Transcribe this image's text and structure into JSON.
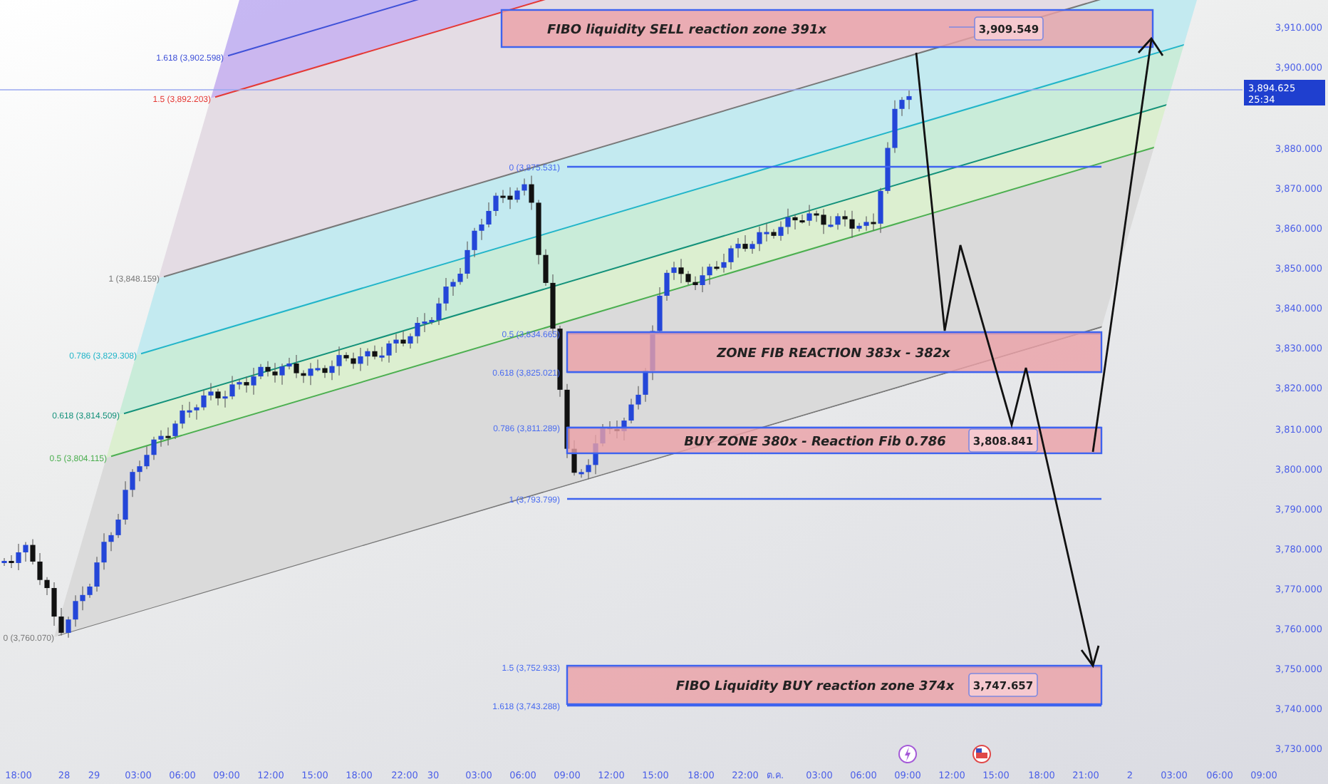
{
  "fib_extension": {
    "levels": [
      {
        "label": "1.618 (3,902.598)",
        "color": "#3f51d8"
      },
      {
        "label": "1.5 (3,892.203)",
        "color": "#e53935"
      },
      {
        "label": "1 (3,848.159)",
        "color": "#787878"
      },
      {
        "label": "0.786 (3,829.308)",
        "color": "#22b5c9"
      },
      {
        "label": "0.618 (3,814.509)",
        "color": "#13917a"
      },
      {
        "label": "0.5 (3,804.115)",
        "color": "#4caf50"
      },
      {
        "label": "0 (3,760.070)",
        "color": "#787878"
      }
    ]
  },
  "fib_retracement": {
    "levels": [
      {
        "label": "0 (3,875.531)"
      },
      {
        "label": "0.5 (3,834.665)"
      },
      {
        "label": "0.618 (3,825.021)"
      },
      {
        "label": "0.786 (3,811.289)"
      },
      {
        "label": "1 (3,793.799)"
      },
      {
        "label": "1.5 (3,752.933)"
      },
      {
        "label": "1.618 (3,743.288)"
      }
    ]
  },
  "zones": [
    {
      "text": "FIBO liquidity SELL reaction zone 391x",
      "price_tag": "3,909.549"
    },
    {
      "text": "ZONE FIB REACTION 383x - 382x"
    },
    {
      "text": "BUY ZONE 380x - Reaction Fib 0.786",
      "price_tag": "3,808.841"
    },
    {
      "text": "FIBO Liquidity BUY reaction zone 374x",
      "price_tag": "3,747.657"
    }
  ],
  "price_axis": {
    "labels": [
      "3,910.000",
      "3,900.000",
      "3,880.000",
      "3,870.000",
      "3,860.000",
      "3,850.000",
      "3,840.000",
      "3,830.000",
      "3,820.000",
      "3,810.000",
      "3,800.000",
      "3,790.000",
      "3,780.000",
      "3,770.000",
      "3,760.000",
      "3,750.000",
      "3,740.000",
      "3,730.000"
    ],
    "current_price": {
      "price": "3,894.625",
      "countdown": "25:34"
    }
  },
  "time_axis": {
    "labels": [
      "18:00",
      "28",
      "29",
      "03:00",
      "06:00",
      "09:00",
      "12:00",
      "15:00",
      "18:00",
      "22:00",
      "30",
      "03:00",
      "06:00",
      "09:00",
      "12:00",
      "15:00",
      "18:00",
      "22:00",
      "ต.ค.",
      "03:00",
      "06:00",
      "09:00",
      "12:00",
      "15:00",
      "18:00",
      "21:00",
      "2",
      "03:00",
      "06:00",
      "09:00"
    ]
  },
  "events": [
    {
      "kind": "lightning"
    },
    {
      "kind": "flag"
    }
  ]
}
